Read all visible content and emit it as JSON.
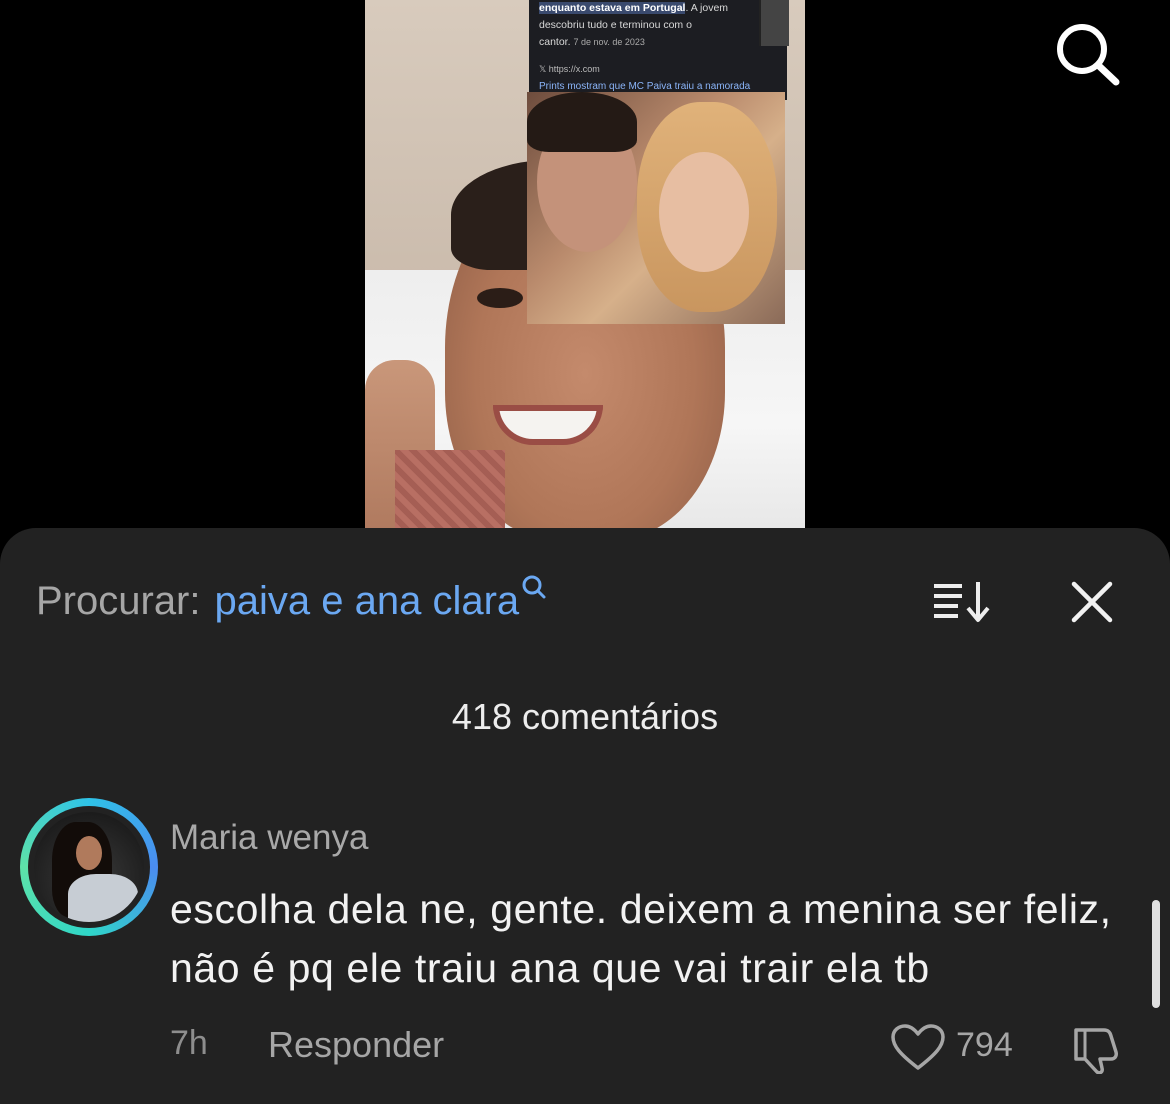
{
  "video": {
    "inset_highlight": "enquanto estava em Portugal",
    "inset_line_after_highlight": ". A jovem",
    "inset_line2": "descobriu tudo e terminou com o",
    "inset_line3": "cantor.",
    "inset_date": "7 de nov. de 2023",
    "inset_source": "https://x.com",
    "inset_headline": "Prints mostram que MC Paiva traiu a namorada"
  },
  "top_search_icon": "search-icon",
  "comments_panel": {
    "search_prefix": "Procurar:",
    "search_query": "paiva e ana clara",
    "comment_count": "418 comentários",
    "sort_icon": "sort-icon",
    "close_icon": "close-icon"
  },
  "comment": {
    "username": "Maria wenya",
    "text": "escolha dela ne, gente. deixem a menina ser feliz, não é pq ele traiu ana que vai trair ela tb",
    "timestamp": "7h",
    "reply_label": "Responder",
    "like_count": "794",
    "avatar_ring_colors": [
      "#2fc3e8",
      "#4b8cf0",
      "#5ee2a8"
    ]
  },
  "colors": {
    "sheet_background": "#222222",
    "query_blue": "#6ba8f2"
  }
}
